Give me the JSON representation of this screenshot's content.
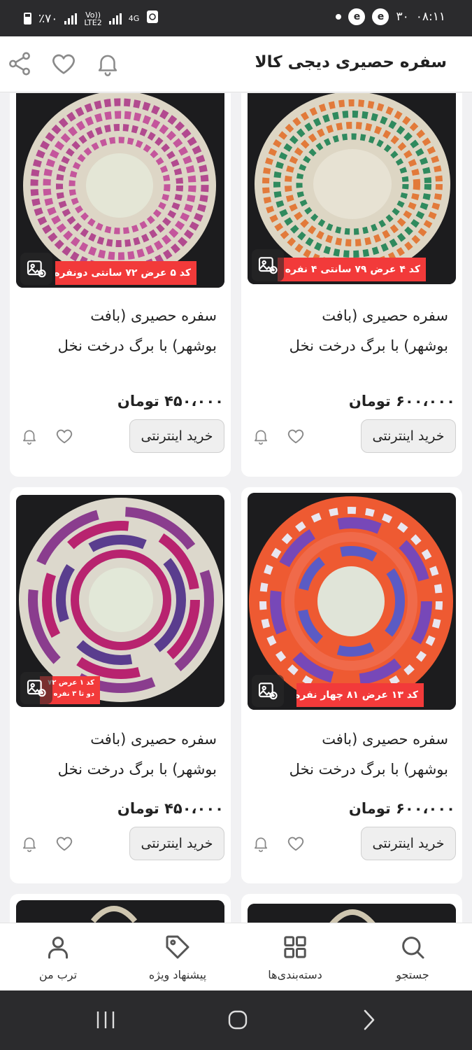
{
  "status_bar": {
    "time": "۰۸:۱۱",
    "temperature": "۳۰",
    "battery": "٪۷۰",
    "volte": "Vo))",
    "lte": "LTE2",
    "network": "4G"
  },
  "header": {
    "title": "سفره حصیری دیجی کالا"
  },
  "products": [
    {
      "name_line1": "سفره حصیری (بافت",
      "name_line2": "بوشهر) با برگ درخت نخل",
      "price": "۶۰۰،۰۰۰ تومان",
      "buy_label": "خرید اینترنتی",
      "badge": "کد ۴ عرض ۷۹ سانتی ۴ نفره"
    },
    {
      "name_line1": "سفره حصیری (بافت",
      "name_line2": "بوشهر) با برگ درخت نخل",
      "price": "۴۵۰،۰۰۰ تومان",
      "buy_label": "خرید اینترنتی",
      "badge": "کد ۵ عرض ۷۲ سانتی دونفره"
    },
    {
      "name_line1": "سفره حصیری (بافت",
      "name_line2": "بوشهر) با برگ درخت نخل",
      "price": "۶۰۰،۰۰۰ تومان",
      "buy_label": "خرید اینترنتی",
      "badge": "کد ۱۳ عرض ۸۱ چهار نفره"
    },
    {
      "name_line1": "سفره حصیری (بافت",
      "name_line2": "بوشهر) با برگ درخت نخل",
      "price": "۴۵۰،۰۰۰ تومان",
      "buy_label": "خرید اینترنتی",
      "badge": "کد ۱ عرض ۷۲ دو تا ۳ نفره"
    }
  ],
  "bottom_nav": {
    "search": "جستجو",
    "categories": "دسته‌بندی‌ها",
    "offers": "پیشنهاد ویژه",
    "profile": "ترب من"
  },
  "colors": {
    "badge": "#f23a3a",
    "status_bar": "#2b2b2d"
  }
}
